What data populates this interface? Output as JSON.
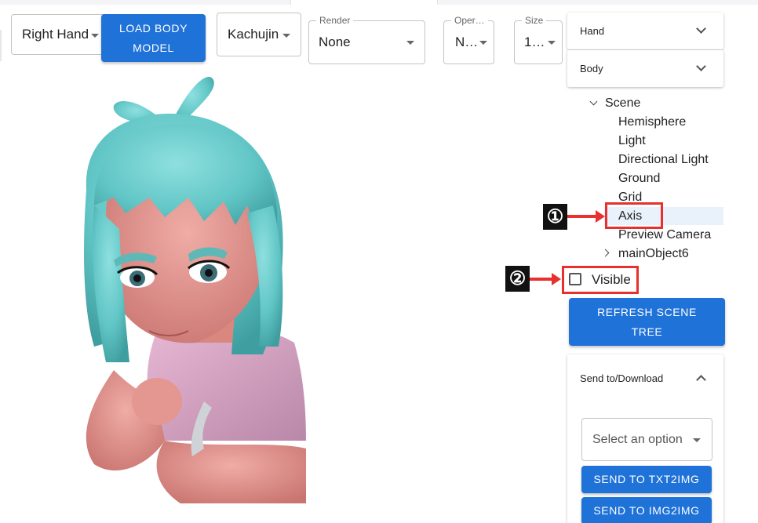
{
  "toolbar": {
    "hand_select": {
      "value": "Right Hand"
    },
    "load_body_button": {
      "line1": "LOAD BODY",
      "line2": "MODEL"
    },
    "model_select": {
      "value": "Kachujin"
    },
    "render_select": {
      "label": "Render",
      "value": "None"
    },
    "operation_select": {
      "label": "Oper…",
      "value": "N…"
    },
    "size_select": {
      "label": "Size",
      "value": "1…"
    }
  },
  "panel": {
    "hand_accordion": {
      "label": "Hand"
    },
    "body_accordion": {
      "label": "Body"
    },
    "scene_tree": {
      "root": "Scene",
      "children": [
        "Hemisphere",
        "Light",
        "Directional Light",
        "Ground",
        "Grid",
        "Axis",
        "Preview Camera",
        "mainObject6"
      ]
    },
    "visible_checkbox": {
      "label": "Visible",
      "checked": false
    },
    "refresh_button": {
      "line1": "REFRESH SCENE",
      "line2": "TREE"
    },
    "send_card": {
      "title": "Send to/Download",
      "select_placeholder": "Select an option",
      "txt2img_button": "SEND TO TXT2IMG",
      "img2img_button": "SEND TO IMG2IMG"
    }
  },
  "annotations": {
    "callout_1": "①",
    "callout_2": "②"
  },
  "colors": {
    "primary_button": "#1f72d8",
    "annotation_red": "#e8302c",
    "hair_teal": "#6ecfcf",
    "skin_pink": "#e89a95",
    "shirt_pink": "#d9a8c6",
    "selected_row": "#e9f1fb"
  }
}
